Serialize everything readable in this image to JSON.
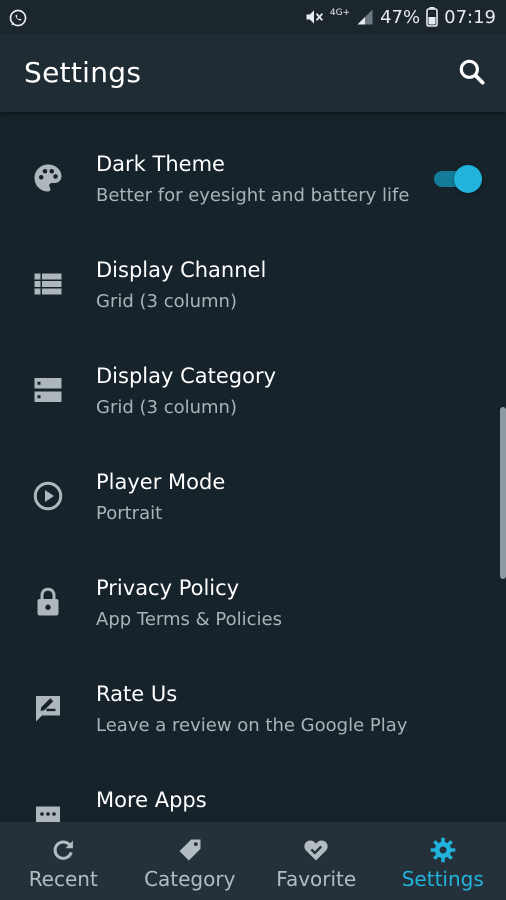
{
  "status_bar": {
    "network": "4G+",
    "battery": "47%",
    "time": "07:19"
  },
  "app_bar": {
    "title": "Settings"
  },
  "settings": [
    {
      "label": "Dark Theme",
      "sub": "Better for eyesight and battery life",
      "icon": "palette-icon",
      "toggle": true
    },
    {
      "label": "Display Channel",
      "sub": "Grid (3 column)",
      "icon": "list-icon"
    },
    {
      "label": "Display Category",
      "sub": "Grid (3 column)",
      "icon": "storage-icon"
    },
    {
      "label": "Player Mode",
      "sub": "Portrait",
      "icon": "play-circle-icon"
    },
    {
      "label": "Privacy Policy",
      "sub": "App Terms & Policies",
      "icon": "lock-icon"
    },
    {
      "label": "Rate Us",
      "sub": "Leave a review on the Google Play",
      "icon": "rate-review-icon"
    },
    {
      "label": "More Apps",
      "sub": "",
      "icon": "shop-icon"
    }
  ],
  "bottom_nav": [
    {
      "label": "Recent",
      "icon": "refresh-icon",
      "active": false
    },
    {
      "label": "Category",
      "icon": "tag-icon",
      "active": false
    },
    {
      "label": "Favorite",
      "icon": "heart-check-icon",
      "active": false
    },
    {
      "label": "Settings",
      "icon": "gear-icon",
      "active": true
    }
  ],
  "colors": {
    "background": "#17232a",
    "app_bar": "#202c33",
    "accent": "#21b3dc",
    "secondary_text": "#a9b3b9"
  }
}
